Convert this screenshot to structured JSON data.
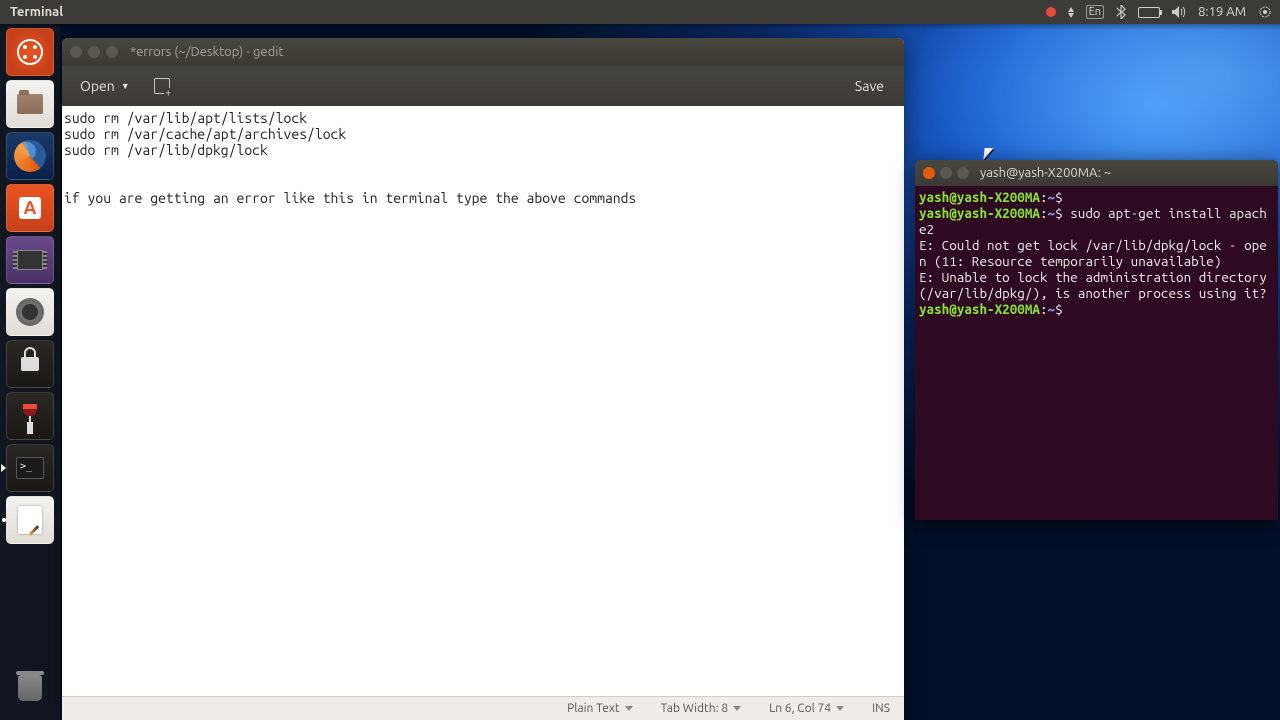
{
  "top_panel": {
    "app_name": "Terminal",
    "language": "En",
    "time": "8:19 AM"
  },
  "launcher": {
    "items": [
      {
        "name": "dash",
        "label": "Dash"
      },
      {
        "name": "files",
        "label": "Files"
      },
      {
        "name": "firefox",
        "label": "Firefox"
      },
      {
        "name": "software",
        "label": "Ubuntu Software"
      },
      {
        "name": "videos",
        "label": "Videos"
      },
      {
        "name": "settings",
        "label": "System Settings"
      },
      {
        "name": "lock",
        "label": "Lock"
      },
      {
        "name": "wine",
        "label": "Wine"
      },
      {
        "name": "terminal",
        "label": "Terminal"
      },
      {
        "name": "gedit",
        "label": "Text Editor"
      },
      {
        "name": "trash",
        "label": "Trash"
      }
    ]
  },
  "gedit": {
    "title": "*errors (~/Desktop) - gedit",
    "open_label": "Open",
    "save_label": "Save",
    "content": "sudo rm /var/lib/apt/lists/lock\nsudo rm /var/cache/apt/archives/lock\nsudo rm /var/lib/dpkg/lock\n\n\nif you are getting an error like this in terminal type the above commands",
    "status": {
      "syntax": "Plain Text",
      "tab_width": "Tab Width: 8",
      "position": "Ln 6, Col 74",
      "mode": "INS"
    }
  },
  "terminal_window": {
    "title": "yash@yash-X200MA: ~",
    "prompt_user": "yash@yash-X200MA",
    "prompt_path": "~",
    "lines": [
      {
        "type": "prompt",
        "cmd": ""
      },
      {
        "type": "prompt",
        "cmd": "sudo apt-get install apache2"
      },
      {
        "type": "out",
        "text": "E: Could not get lock /var/lib/dpkg/lock - open (11: Resource temporarily unavailable)"
      },
      {
        "type": "out",
        "text": "E: Unable to lock the administration directory (/var/lib/dpkg/), is another process using it?"
      },
      {
        "type": "prompt",
        "cmd": ""
      }
    ]
  }
}
